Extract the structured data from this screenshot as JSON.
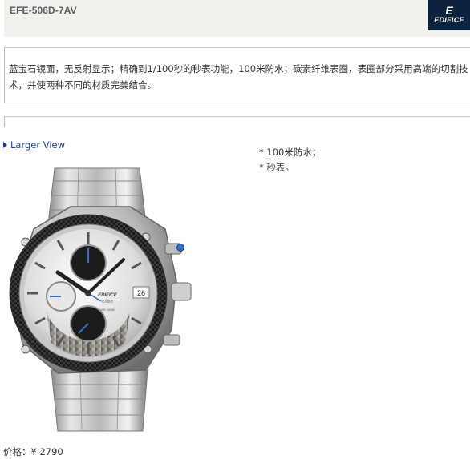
{
  "header": {
    "model": "EFE-506D-7AV",
    "logo": {
      "mark": "E",
      "word": "EDIFICE",
      "background": "#0c2340"
    }
  },
  "description": "蓝宝石镜面，无反射显示；精确到1/100秒的秒表功能，100米防水；碳素纤维表圈，表圈部分采用高端的切割技术，并使两种不同的材质完美结合。",
  "larger_view": {
    "label": "Larger View",
    "icon": "triangle-right-icon",
    "color": "#1a3f99"
  },
  "watch": {
    "dial_brand": "EDIFICE",
    "dial_sub": "CASIO",
    "dial_wr": "WR 100M",
    "date": "26"
  },
  "features": [
    "* 100米防水；",
    "* 秒表。"
  ],
  "price": {
    "label": "价格：",
    "currency": "¥",
    "value": "2790"
  }
}
